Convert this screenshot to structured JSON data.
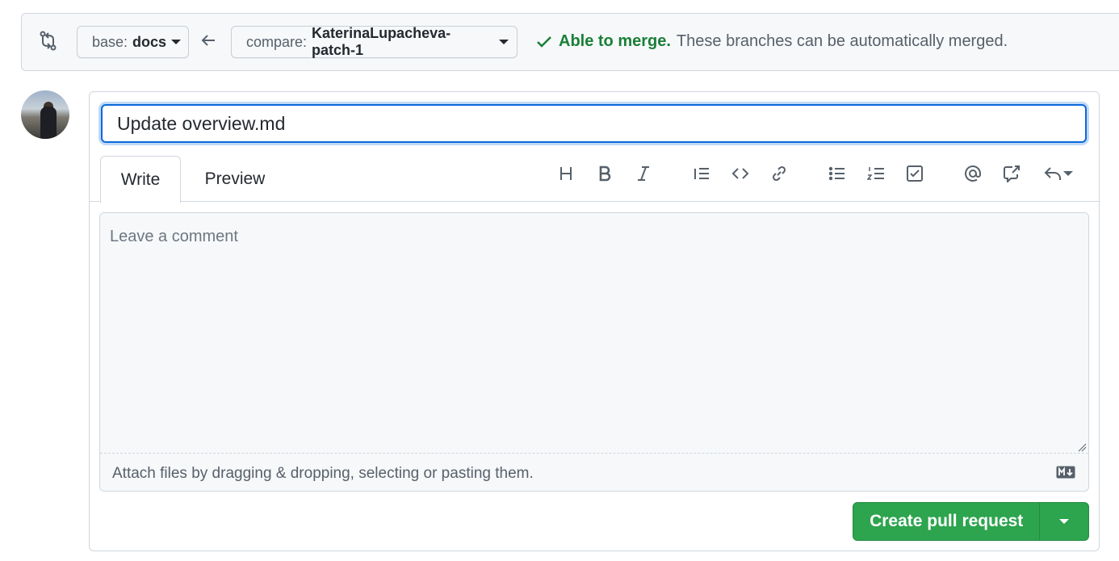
{
  "range": {
    "base_prefix": "base:",
    "base_branch": "docs",
    "compare_prefix": "compare:",
    "compare_branch": "KaterinaLupacheva-patch-1",
    "merge_status_bold": "Able to merge.",
    "merge_status_text": "These branches can be automatically merged."
  },
  "form": {
    "title_value": "Update overview.md",
    "tabs": [
      {
        "label": "Write",
        "active": true
      },
      {
        "label": "Preview",
        "active": false
      }
    ],
    "toolbar": [
      "heading-icon",
      "bold-icon",
      "italic-icon",
      "quote-icon",
      "code-icon",
      "link-icon",
      "bulleted-list-icon",
      "numbered-list-icon",
      "task-list-icon",
      "mention-icon",
      "cross-reference-icon",
      "saved-replies-icon"
    ],
    "comment_placeholder": "Leave a comment",
    "attach_text": "Attach files by dragging & dropping, selecting or pasting them.",
    "submit_label": "Create pull request"
  },
  "colors": {
    "accent": "#0969da",
    "success": "#1a7f37",
    "primary_button": "#2da44e"
  }
}
